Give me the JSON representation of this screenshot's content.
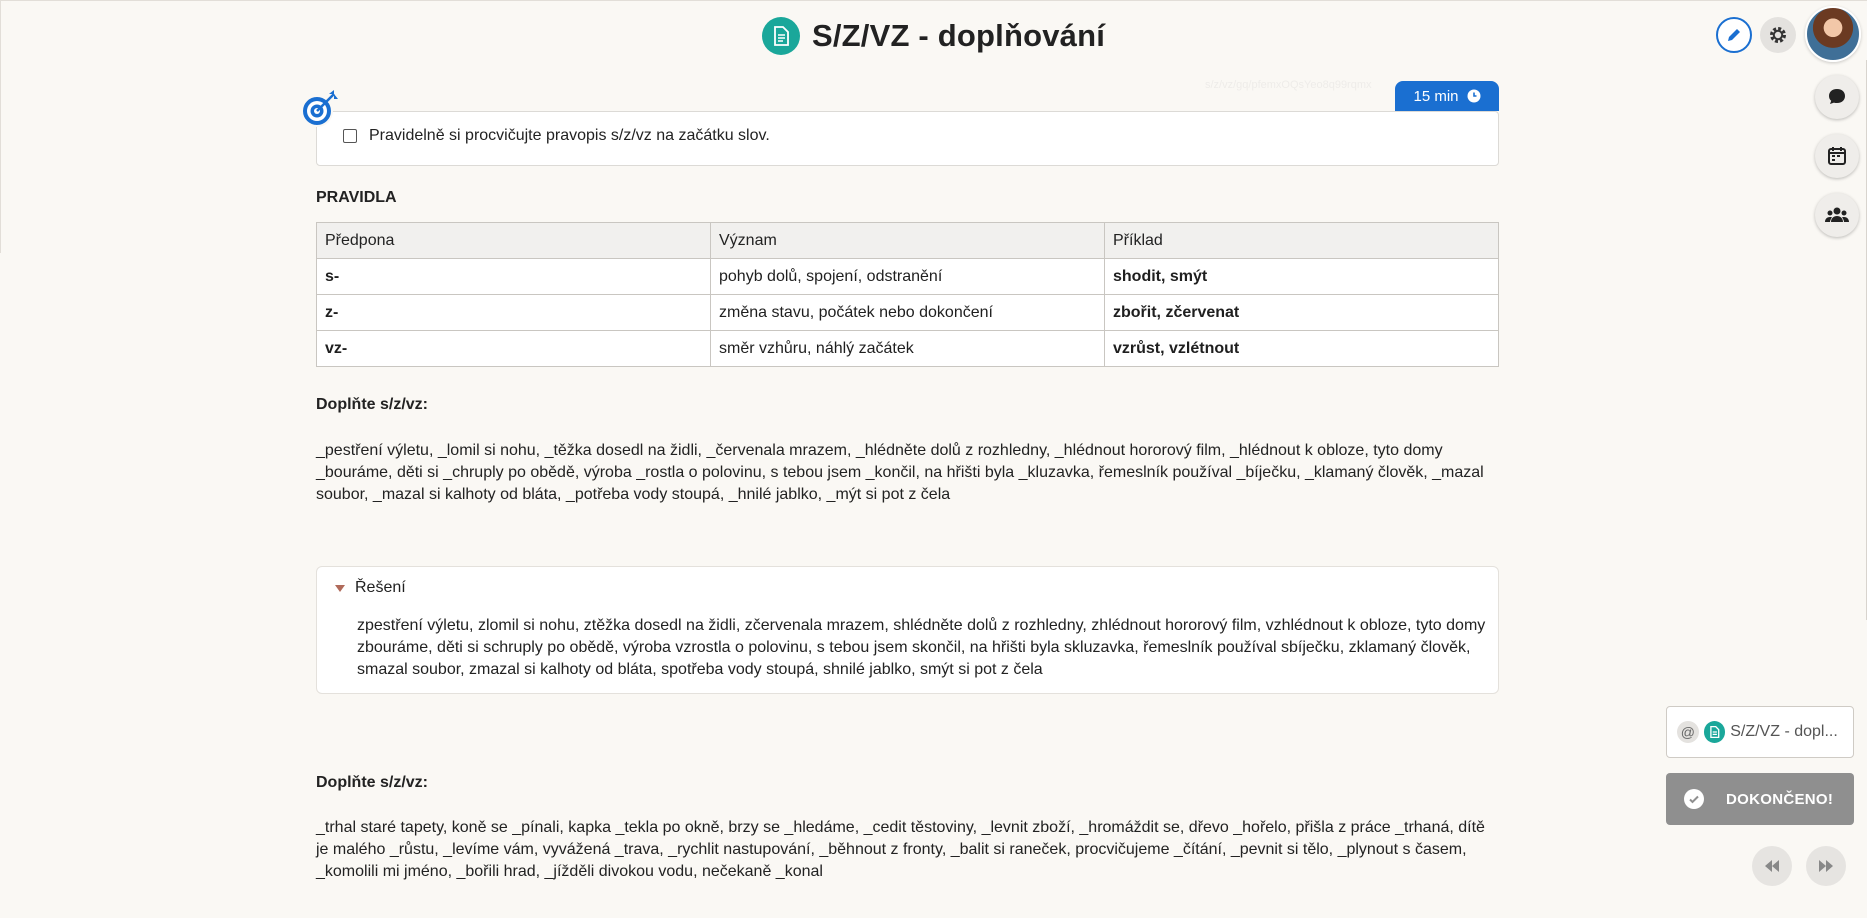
{
  "header": {
    "title": "S/Z/VZ - doplňování",
    "title_icon": "document-icon"
  },
  "top_controls": {
    "edit_icon": "pencil-icon",
    "settings_icon": "gear-icon",
    "avatar": "user-avatar"
  },
  "side_buttons": [
    "chat-icon",
    "calendar-icon",
    "group-icon"
  ],
  "goal": {
    "text": "Pravidelně si procvičujte pravopis s/z/vz na začátku slov.",
    "time": "15 min",
    "faint_text": "s/z/vz/gq/pfemxOQsYeo8q99rqmx"
  },
  "rules": {
    "heading": "PRAVIDLA",
    "columns": [
      "Předpona",
      "Význam",
      "Příklad"
    ],
    "rows": [
      [
        "s-",
        "pohyb dolů, spojení, odstranění",
        "shodit, smýt"
      ],
      [
        "z-",
        "změna stavu, počátek nebo dokončení",
        "zbořit, zčervenat"
      ],
      [
        "vz-",
        "směr vzhůru, náhlý začátek",
        "vzrůst, vzlétnout"
      ]
    ]
  },
  "exercise1": {
    "heading": "Doplňte s/z/vz:",
    "text": "_pestření výletu, _lomil si nohu, _těžka dosedl na židli, _červenala mrazem, _hlédněte dolů z rozhledny, _hlédnout hororový film, _hlédnout k obloze, tyto domy _bouráme, děti si _chruply po obědě, výroba _rostla o polovinu, s tebou jsem _končil, na hřišti byla _kluzavka, řemeslník používal _bíječku, _klamaný člověk, _mazal soubor, _mazal si kalhoty od bláta, _potřeba vody stoupá, _hnilé jablko, _mýt si pot z čela"
  },
  "solution": {
    "label": "Řešení",
    "text": "zpestření výletu, zlomil si nohu, ztěžka dosedl na židli, zčervenala mrazem, shlédněte dolů z rozhledny, zhlédnout hororový film, vzhlédnout k obloze, tyto domy zbouráme, děti si schruply po obědě, výroba vzrostla o polovinu, s tebou jsem skončil, na hřišti byla skluzavka, řemeslník používal sbíječku, zklamaný člověk, smazal soubor, zmazal si kalhoty od bláta, spotřeba vody stoupá, shnilé jablko, smýt si pot z čela"
  },
  "exercise2": {
    "heading": "Doplňte s/z/vz:",
    "text": "_trhal staré tapety, koně se _pínali, kapka _tekla po okně, brzy se _hledáme, _cedit těstoviny, _levnit zboží, _hromáždit se, dřevo _hořelo, přišla z práce _trhaná, dítě je malého _růstu, _levíme vám, vyvážená _trava, _rychlit nastupování, _běhnout z fronty, _balit si raneček, procvičujeme _čítání, _pevnit si tělo, _plynout s časem, _komolili mi jméno, _bořili hrad, _jížděli divokou vodu, nečekaně _konal"
  },
  "widgets": {
    "ref_at": "@",
    "ref_text": "S/Z/VZ - dopl...",
    "done_label": "DOKONČENO!",
    "prev_icon": "rewind-icon",
    "next_icon": "fast-forward-icon"
  },
  "colors": {
    "accent": "#1a6fd1",
    "teal": "#1aa79a",
    "done": "#8f8f8f"
  }
}
